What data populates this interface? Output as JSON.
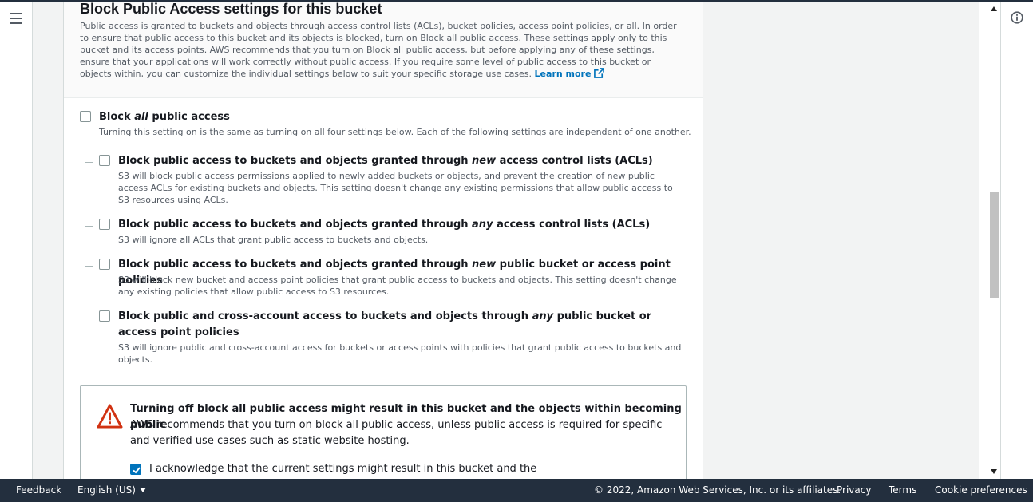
{
  "section": {
    "title": "Block Public Access settings for this bucket",
    "description": "Public access is granted to buckets and objects through access control lists (ACLs), bucket policies, access point policies, or all. In order to ensure that public access to this bucket and its objects is blocked, turn on Block all public access. These settings apply only to this bucket and its access points. AWS recommends that you turn on Block all public access, but before applying any of these settings, ensure that your applications will work correctly without public access. If you require some level of public access to this bucket or objects within, you can customize the individual settings below to suit your specific storage use cases.",
    "learn_more": "Learn more"
  },
  "block_all": {
    "pre": "Block ",
    "em": "all",
    "post": " public access",
    "desc": "Turning this setting on is the same as turning on all four settings below. Each of the following settings are independent of one another.",
    "checked": false
  },
  "options": [
    {
      "pre": "Block public access to buckets and objects granted through ",
      "em": "new",
      "post": " access control lists (ACLs)",
      "desc": "S3 will block public access permissions applied to newly added buckets or objects, and prevent the creation of new public access ACLs for existing buckets and objects. This setting doesn't change any existing permissions that allow public access to S3 resources using ACLs.",
      "checked": false
    },
    {
      "pre": "Block public access to buckets and objects granted through ",
      "em": "any",
      "post": " access control lists (ACLs)",
      "desc": "S3 will ignore all ACLs that grant public access to buckets and objects.",
      "checked": false
    },
    {
      "pre": "Block public access to buckets and objects granted through ",
      "em": "new",
      "post": " public bucket or access point policies",
      "desc": "S3 will block new bucket and access point policies that grant public access to buckets and objects. This setting doesn't change any existing policies that allow public access to S3 resources.",
      "checked": false
    },
    {
      "pre": "Block public and cross-account access to buckets and objects through ",
      "em": "any",
      "post": " public bucket or access point policies",
      "desc": "S3 will ignore public and cross-account access for buckets or access points with policies that grant public access to buckets and objects.",
      "checked": false
    }
  ],
  "warning": {
    "title": "Turning off block all public access might result in this bucket and the objects within becoming public",
    "text": "AWS recommends that you turn on block all public access, unless public access is required for specific and verified use cases such as static website hosting.",
    "ack_label": "I acknowledge that the current settings might result in this bucket and the",
    "ack_checked": true
  },
  "footer": {
    "feedback": "Feedback",
    "language": "English (US)",
    "copyright": "© 2022, Amazon Web Services, Inc. or its affiliates.",
    "privacy": "Privacy",
    "terms": "Terms",
    "cookie": "Cookie preferences"
  },
  "icons": {
    "menu": "hamburger-menu-icon",
    "info": "info-icon",
    "external": "external-link-icon",
    "warning": "warning-triangle-icon",
    "check": "checkmark-icon"
  },
  "colors": {
    "link": "#0073bb",
    "warning": "#d13212",
    "footer_bg": "#232f3e",
    "checkbox_checked": "#0073bb"
  }
}
